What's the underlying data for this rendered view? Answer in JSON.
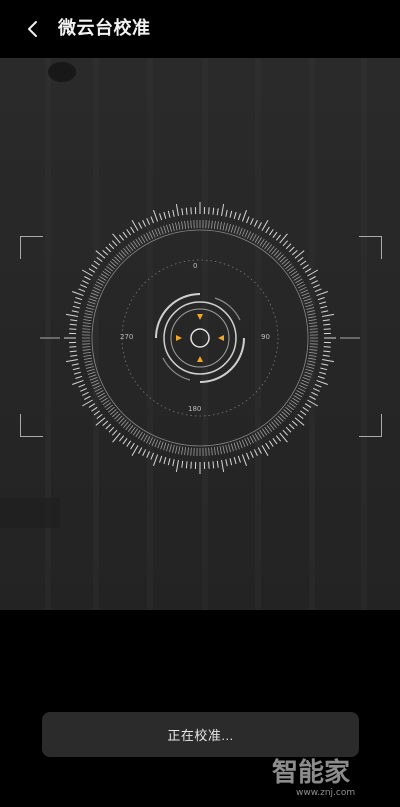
{
  "header": {
    "title": "微云台校准",
    "back_icon": "chevron-left-icon"
  },
  "dial": {
    "labels": {
      "top": "0",
      "right": "90",
      "bottom": "180",
      "left": "270"
    },
    "accent_color": "#f5a623"
  },
  "status": {
    "label": "正在校准..."
  },
  "watermark": {
    "text": "智能家",
    "url": "www.znj.com"
  }
}
